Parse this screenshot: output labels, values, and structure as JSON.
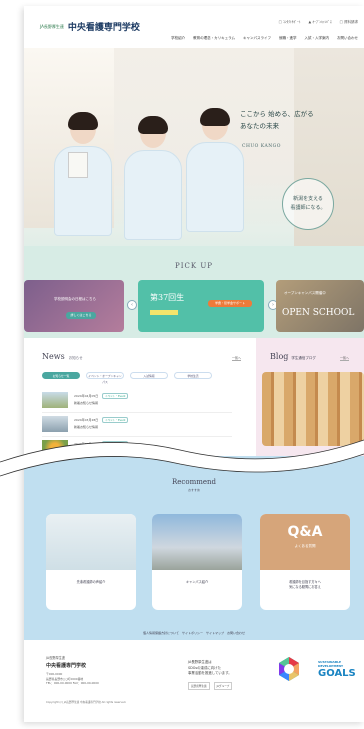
{
  "header": {
    "brand_ja": "JA長野厚生連",
    "brand_name": "中央看護専門学校",
    "util_links": [
      "□ ｺﾝﾀｸﾄｻﾎﾟｰﾄ",
      "▲ ｵｰﾌﾟﾝｷｬﾝﾊﾟｽ",
      "□ 資料請求"
    ],
    "gnav": [
      "学校紹介",
      "教育の理念・カリキュラム",
      "キャンパスライフ",
      "就職・進学",
      "入試・入学案内",
      "お問い合わせ"
    ]
  },
  "hero": {
    "copy_line1": "ここから 始める、広がる",
    "copy_line2": "あなたの未来",
    "sub": "CHUO KANGO",
    "badge_line1": "新潟を支える",
    "badge_line2": "看護師になる。"
  },
  "pickup": {
    "title": "PICK UP",
    "card1_text": "学校説明会の日程はこちら",
    "card1_btn": "詳しくはこちら",
    "card2_big": "第37回生",
    "card2_btn": "学費・奨学金サポート",
    "card3_text": "オープンキャンパス開催中",
    "card3_big": "OPEN SCHOOL"
  },
  "news": {
    "title": "News",
    "title_sub": "お知らせ",
    "more": "一覧へ",
    "tabs": [
      "お知らせ一覧",
      "イベント・オープンキャンパス",
      "入試情報",
      "学校生活"
    ],
    "items": [
      {
        "date": "2024年04月05日",
        "tag": "イベント・Event",
        "text": "新着お知らせ情報"
      },
      {
        "date": "2024年03月28日",
        "tag": "イベント・Event",
        "text": "新着お知らせ情報"
      },
      {
        "date": "2024年03月15日",
        "tag": "イベント・Event",
        "text": "新着お知らせ"
      }
    ]
  },
  "blog": {
    "title": "Blog",
    "title_sub": "学生通信ブログ",
    "more": "一覧へ"
  },
  "recommend": {
    "title": "Recommend",
    "sub": "おすすめ",
    "cards": [
      {
        "label": "先輩看護師の声紹介"
      },
      {
        "label": "キャンパス紹介"
      },
      {
        "label": "看護師を目指す方々へ\n気になる疑問にお答え"
      }
    ],
    "qa_big": "Q&A",
    "qa_sub": "よくある質問"
  },
  "footer": {
    "links": "個人情報保護方針について　サイトポリシー　サイトマップ　お問い合わせ",
    "org": "JA長野厚生連",
    "name": "中央看護専門学校",
    "address_line1": "〒000-0000",
    "address_line2": "長野県長野市○○町0000番地",
    "address_line3": "TEL：000-00-0000  FAX：000-00-0000",
    "copyright": "Copyright (c) JA長野厚生連 中央看護専門学校 All rights reserved.",
    "sdgs_line1": "JA長野厚生連は",
    "sdgs_line2": "SDGsの達成に向けた",
    "sdgs_line3": "事業活動を推進しています。",
    "small_logo1": "長野県厚生連",
    "small_logo2": "JAグループ",
    "goals_line1": "SUSTAINABLE",
    "goals_line2": "DEVELOPMENT",
    "goals_big": "GOALS"
  },
  "colors": {
    "accent": "#4aa7a0",
    "pickup_bg": "#d7ece5",
    "recommend_bg": "#c0dff0",
    "blog_bg": "#f6e7ef"
  }
}
